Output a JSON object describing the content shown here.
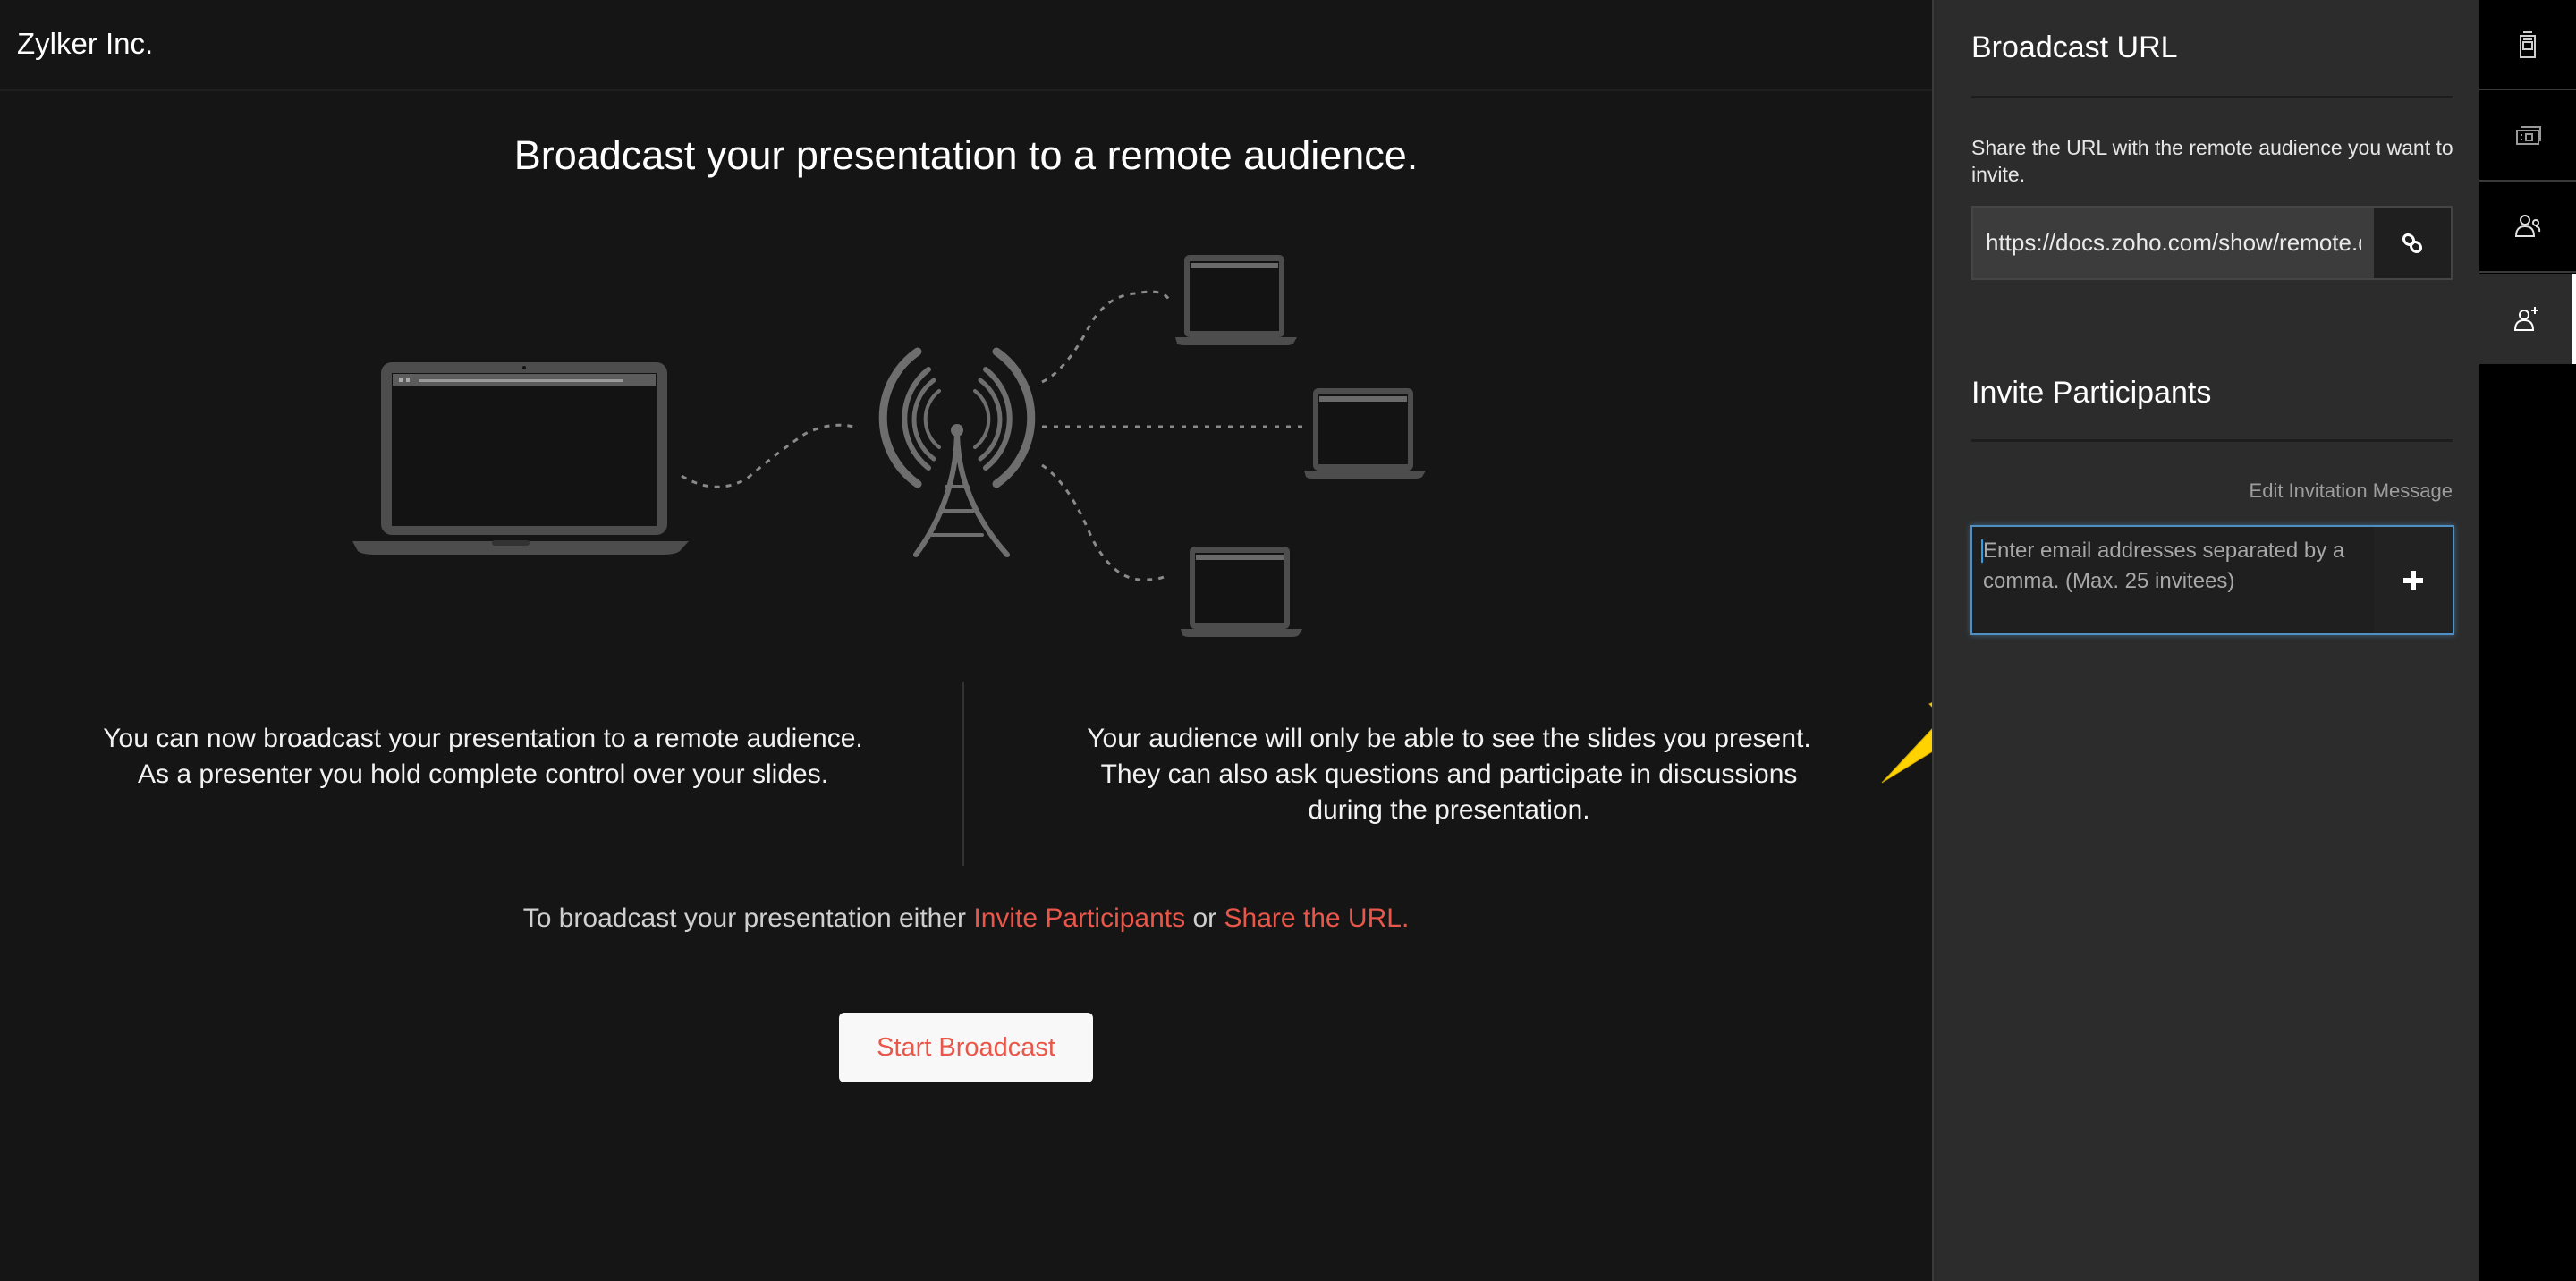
{
  "header": {
    "brand": "Zylker Inc."
  },
  "main": {
    "title": "Broadcast your presentation to a remote audience.",
    "left_paragraph": [
      "You can now broadcast your presentation to a remote audience.",
      "As a presenter you hold complete control over your slides."
    ],
    "right_paragraph": [
      "Your audience will only be able to see the slides you present.",
      "They can also ask questions and participate in discussions",
      "during the presentation."
    ],
    "cta": {
      "prefix": "To broadcast your presentation either ",
      "link1": "Invite Participants",
      "middle": " or ",
      "link2": "Share the URL."
    },
    "start_button": "Start Broadcast",
    "illustration": {
      "presenter": "laptop-icon",
      "tower": "broadcast-tower-icon",
      "audience_devices": 3
    }
  },
  "panel": {
    "url_section": {
      "heading": "Broadcast URL",
      "description": "Share the URL with the remote audience you want to invite.",
      "url_value": "https://docs.zoho.com/show/remote.d",
      "copy_icon": "link-icon"
    },
    "invite_section": {
      "heading": "Invite Participants",
      "edit_message_link": "Edit Invitation Message",
      "email_placeholder": "Enter email addresses separated by a comma. (Max. 25 invitees)",
      "email_value": "",
      "add_icon": "plus-icon"
    }
  },
  "rail": {
    "items": [
      {
        "icon": "slide-notes-icon",
        "active": false
      },
      {
        "icon": "slides-panel-icon",
        "active": false
      },
      {
        "icon": "audience-icon",
        "active": false
      },
      {
        "icon": "add-participant-icon",
        "active": true
      }
    ]
  },
  "colors": {
    "accent": "#e8574a",
    "focus": "#4f8fc4",
    "annotation_arrow": "#ffd200",
    "background": "#151515",
    "panel": "#2c2c2c"
  }
}
